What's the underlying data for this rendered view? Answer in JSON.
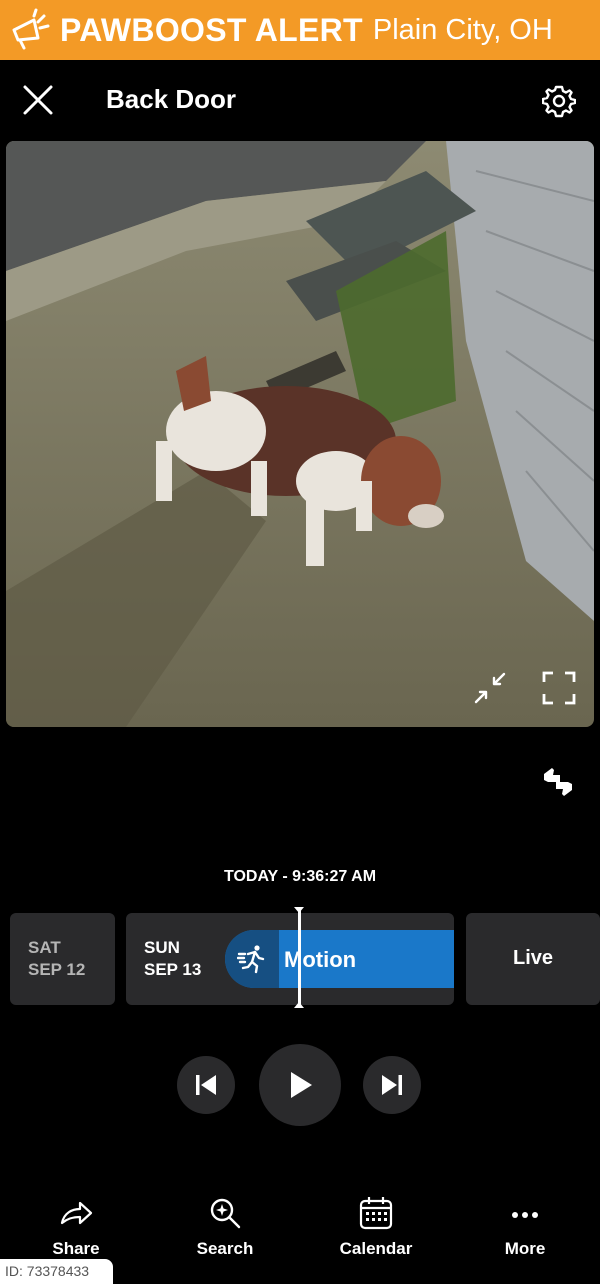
{
  "banner": {
    "brand": "PAWBOOST ALERT",
    "location": "Plain City, OH",
    "color": "#f39a26"
  },
  "header": {
    "title": "Back Door",
    "close_icon": "close-icon",
    "settings_icon": "gear-icon"
  },
  "video": {
    "controls": [
      "collapse-icon",
      "fullscreen-icon"
    ]
  },
  "feedback_icon": "thumbs-feedback-icon",
  "timeline": {
    "timestamp": "TODAY - 9:36:27 AM",
    "days": [
      {
        "weekday": "SAT",
        "date": "SEP 12"
      },
      {
        "weekday": "SUN",
        "date": "SEP 13"
      }
    ],
    "event_label": "Motion",
    "event_icon": "motion-runner-icon",
    "event_color": "#1a78c9",
    "live_label": "Live"
  },
  "playback": {
    "controls": [
      "skip-previous-icon",
      "play-icon",
      "skip-next-icon"
    ]
  },
  "bottom_nav": {
    "items": [
      {
        "label": "Share",
        "icon": "share-icon"
      },
      {
        "label": "Search",
        "icon": "search-icon"
      },
      {
        "label": "Calendar",
        "icon": "calendar-icon"
      },
      {
        "label": "More",
        "icon": "more-icon"
      }
    ]
  },
  "watermark_id": "ID: 73378433"
}
